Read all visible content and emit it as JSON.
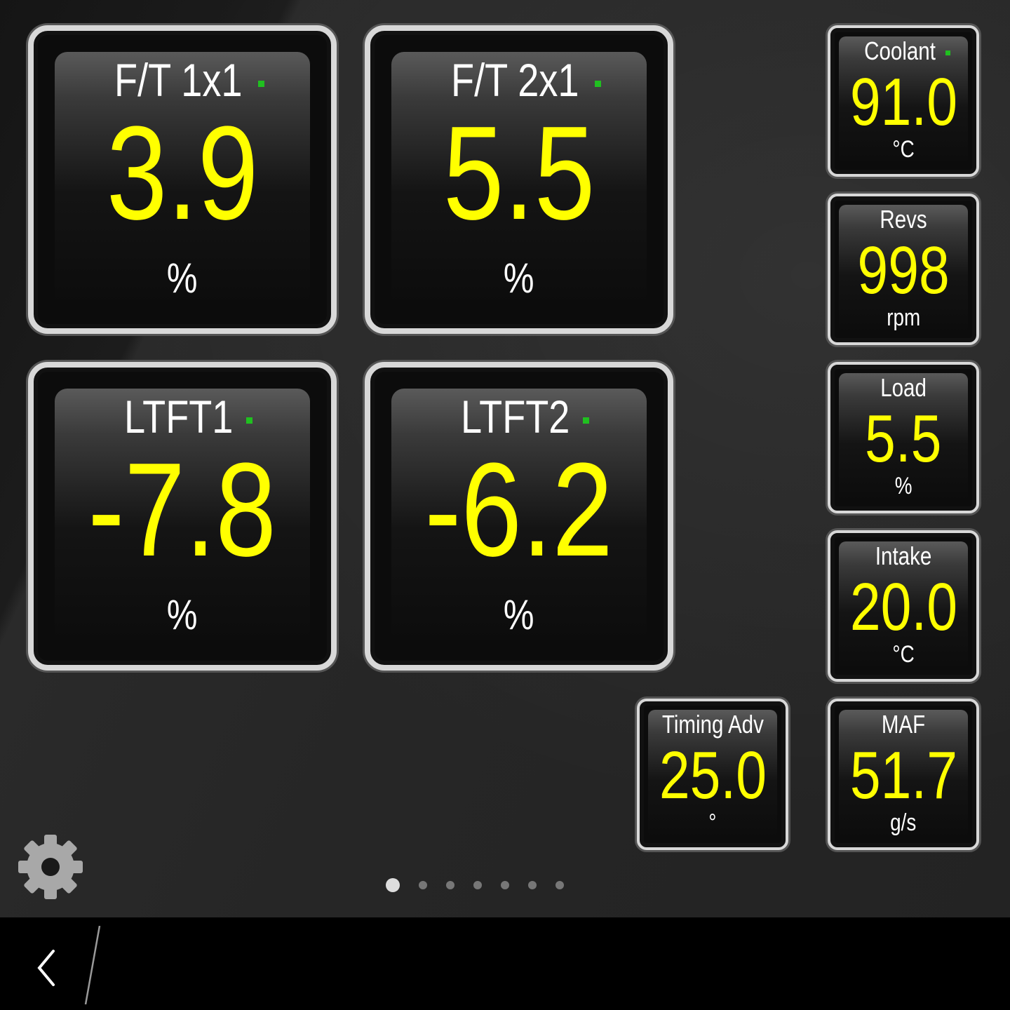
{
  "gauges": [
    {
      "label": "F/T 1x1",
      "value": "3.9",
      "unit": "%"
    },
    {
      "label": "F/T 2x1",
      "value": "5.5",
      "unit": "%"
    },
    {
      "label": "LTFT1",
      "value": "-7.8",
      "unit": "%"
    },
    {
      "label": "LTFT2",
      "value": "-6.2",
      "unit": "%"
    },
    {
      "label": "Coolant",
      "value": "91.0",
      "unit": "°C"
    },
    {
      "label": "Revs",
      "value": "998",
      "unit": "rpm"
    },
    {
      "label": "Load",
      "value": "5.5",
      "unit": "%"
    },
    {
      "label": "Intake",
      "value": "20.0",
      "unit": "°C"
    },
    {
      "label": "Timing Adv",
      "value": "25.0",
      "unit": "°"
    },
    {
      "label": "MAF",
      "value": "51.7",
      "unit": "g/s"
    }
  ],
  "colors": {
    "value": "#ffff00",
    "label": "#ffffff",
    "indicator": "#20c020"
  },
  "pager": {
    "pages": 7,
    "current": 1
  },
  "icons": {
    "settings": "gear-icon",
    "back": "back-chevron-icon"
  }
}
